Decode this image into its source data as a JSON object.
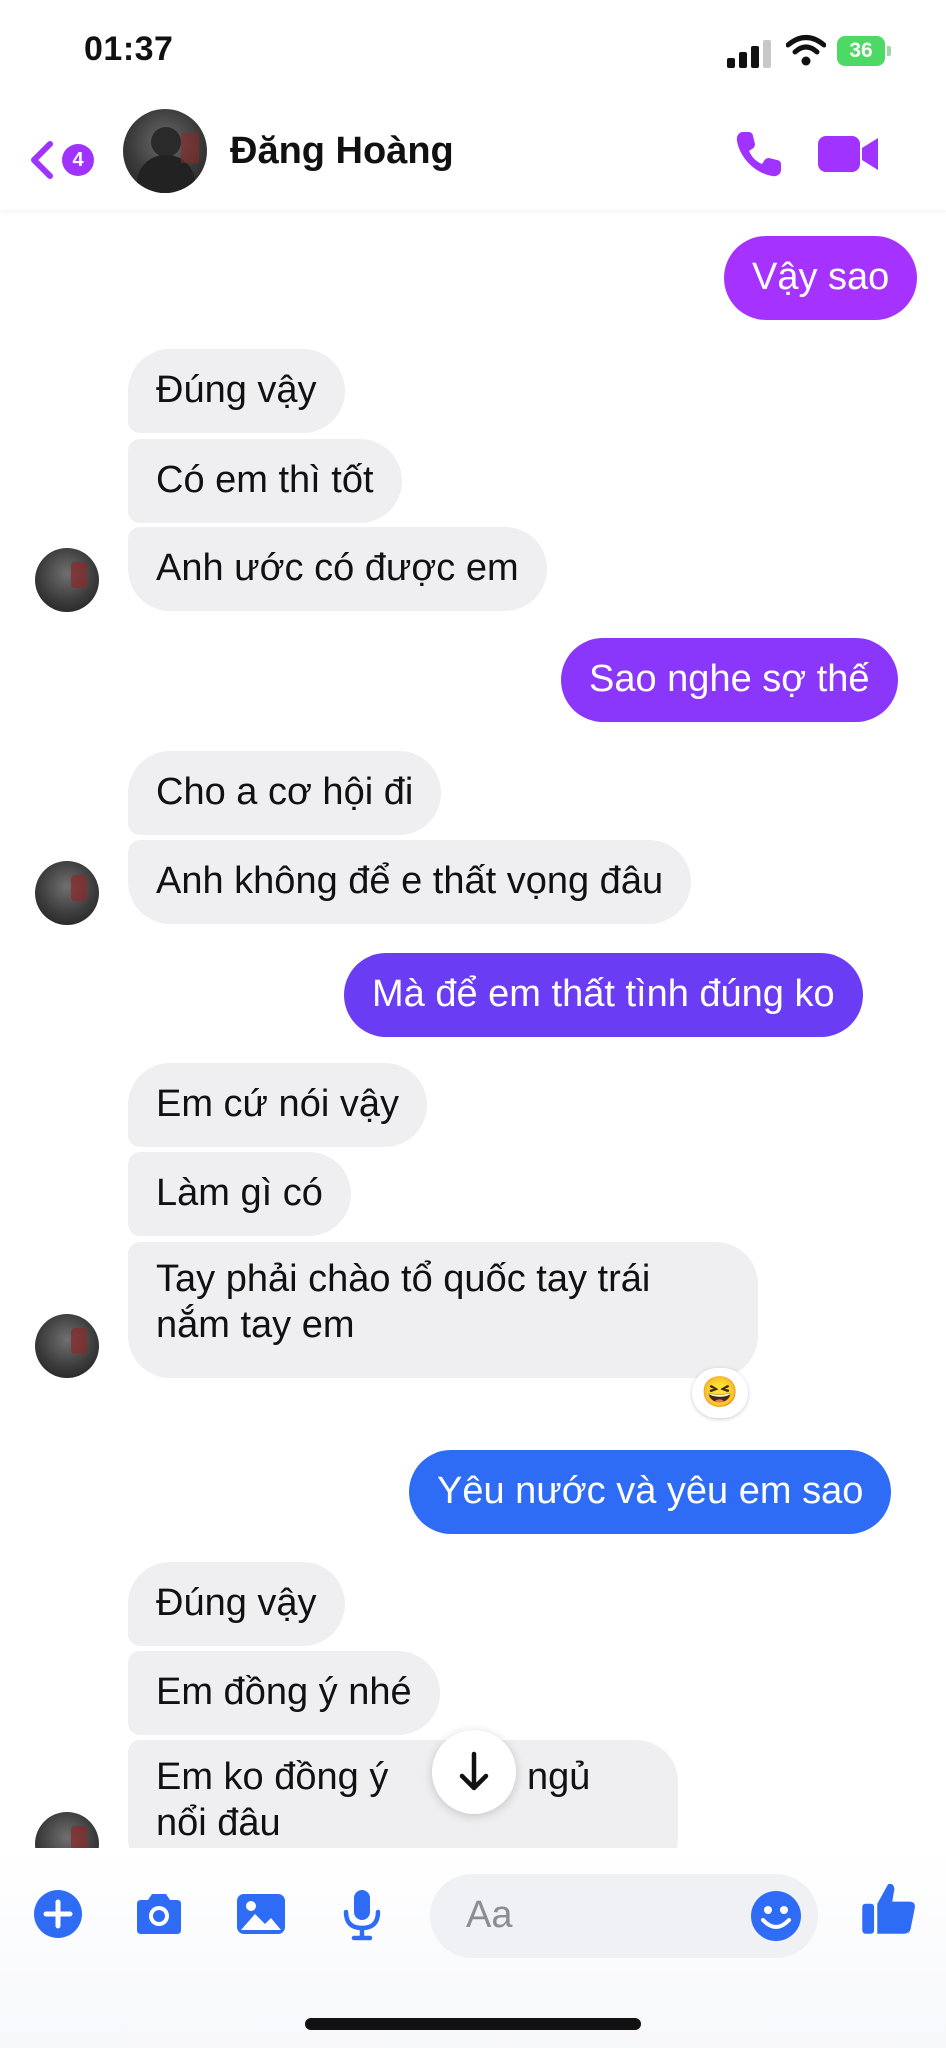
{
  "status_bar": {
    "time": "01:37",
    "battery": "36"
  },
  "header": {
    "unread_count": "4",
    "contact_name": "Đăng Hoàng"
  },
  "messages": [
    {
      "text": "Vậy sao"
    },
    {
      "text": "Đúng vậy"
    },
    {
      "text": "Có em thì tốt"
    },
    {
      "text": "Anh ước có được em"
    },
    {
      "text": "Sao nghe sợ thế"
    },
    {
      "text": "Cho a cơ hội đi"
    },
    {
      "text": "Anh không để e thất vọng đâu"
    },
    {
      "text": "Mà để em thất tình đúng ko"
    },
    {
      "text": "Em cứ nói vậy"
    },
    {
      "text": "Làm gì có"
    },
    {
      "text": "Tay phải chào tổ quốc tay trái"
    },
    {
      "text": "nắm tay em"
    },
    {
      "text": "Yêu nước và yêu em sao"
    },
    {
      "text": "Đúng vậy"
    },
    {
      "text": "Em đồng ý nhé"
    },
    {
      "text": "Em ko đồng ý"
    },
    {
      "text": "ko ngủ"
    },
    {
      "text": "nổi đâu"
    }
  ],
  "reaction": "😆",
  "composer": {
    "placeholder": "Aa"
  },
  "colors": {
    "accent": "#a033ff",
    "out_top": "#a532fe",
    "out_mid": "#6a3df5",
    "out_bottom": "#2f6cf5",
    "in_bubble": "#efeff1"
  },
  "icons": [
    "signal-icon",
    "wifi-icon",
    "battery-icon",
    "back-chevron-icon",
    "phone-icon",
    "video-camera-icon",
    "arrow-down-icon",
    "plus-icon",
    "camera-icon",
    "image-icon",
    "microphone-icon",
    "emoji-icon",
    "thumbs-up-icon"
  ]
}
